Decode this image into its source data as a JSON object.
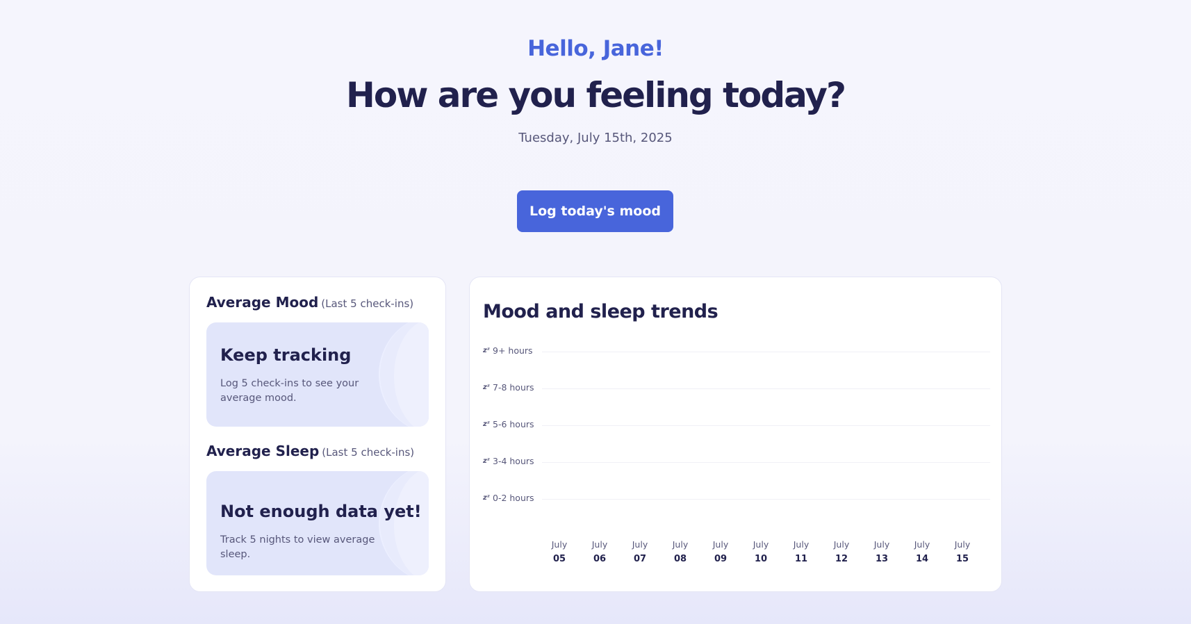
{
  "header": {
    "greeting": "Hello, Jane!",
    "headline": "How are you feeling today?",
    "date": "Tuesday, July 15th, 2025"
  },
  "actions": {
    "log_mood_label": "Log today's mood"
  },
  "averages": {
    "mood": {
      "title": "Average Mood",
      "subtitle": "(Last 5 check-ins)",
      "box_title": "Keep tracking",
      "box_text": "Log 5 check-ins to see your average mood."
    },
    "sleep": {
      "title": "Average Sleep",
      "subtitle": "(Last 5 check-ins)",
      "box_title": "Not enough data yet!",
      "box_text": "Track 5 nights to view average sleep."
    }
  },
  "chart_data": {
    "type": "bar",
    "title": "Mood and sleep trends",
    "y_categories": [
      "9+ hours",
      "7-8 hours",
      "5-6 hours",
      "3-4 hours",
      "0-2 hours"
    ],
    "categories": [
      {
        "month": "July",
        "day": "05"
      },
      {
        "month": "July",
        "day": "06"
      },
      {
        "month": "July",
        "day": "07"
      },
      {
        "month": "July",
        "day": "08"
      },
      {
        "month": "July",
        "day": "09"
      },
      {
        "month": "July",
        "day": "10"
      },
      {
        "month": "July",
        "day": "11"
      },
      {
        "month": "July",
        "day": "12"
      },
      {
        "month": "July",
        "day": "13"
      },
      {
        "month": "July",
        "day": "14"
      },
      {
        "month": "July",
        "day": "15"
      }
    ],
    "series": [],
    "grid": true,
    "legend": "none"
  },
  "icons": {
    "sleep_icon": "zzz-icon"
  },
  "colors": {
    "accent": "#4865db",
    "text_dark": "#21214d",
    "text_muted": "#57577a",
    "box_bg": "#e1e5fa"
  }
}
